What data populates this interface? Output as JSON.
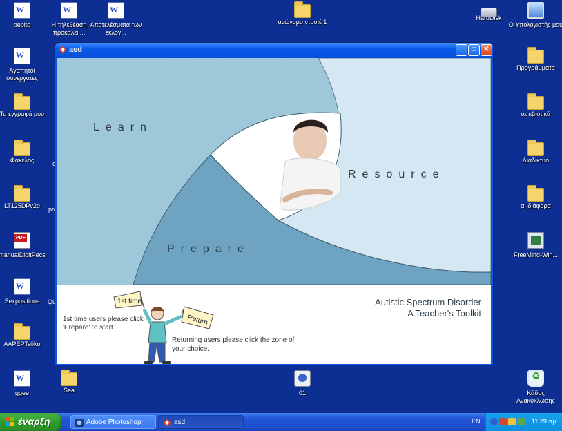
{
  "desktop": {
    "icons": [
      {
        "label": "pepito",
        "icon": "word-doc-icon"
      },
      {
        "label": "Η τηλεθέαση προκαλεί ...",
        "icon": "word-doc-icon"
      },
      {
        "label": "Αποτελέσματα των εκλογ...",
        "icon": "word-doc-icon"
      },
      {
        "label": "ανώνυμο ντοσιέ 1",
        "icon": "folder-icon"
      },
      {
        "label": "HardDisk",
        "icon": "drive-icon"
      },
      {
        "label": "Ο Υπολογιστής μου",
        "icon": "computer-icon"
      },
      {
        "label": "Αγαπητοί συνεργάτες",
        "icon": "word-doc-icon"
      },
      {
        "label": "Τα έγγραφά μου",
        "icon": "folder-icon"
      },
      {
        "label": "Φάκελος",
        "icon": "folder-icon"
      },
      {
        "label": "LT125DPv2p",
        "icon": "folder-icon"
      },
      {
        "label": "manualDigitPecs",
        "icon": "pdf-icon"
      },
      {
        "label": "Sexpositions",
        "icon": "word-doc-icon"
      },
      {
        "label": "AAPEPTeliko",
        "icon": "folder-icon"
      },
      {
        "label": "ggee",
        "icon": "word-doc-icon"
      },
      {
        "label": "Sea",
        "icon": "folder-icon"
      },
      {
        "label": "01",
        "icon": "media-icon"
      },
      {
        "label": "Προγράμματα",
        "icon": "folder-icon"
      },
      {
        "label": "αντιβιοτικά",
        "icon": "folder-icon"
      },
      {
        "label": "Διαδίκτυο",
        "icon": "folder-icon"
      },
      {
        "label": "α_διάφορα",
        "icon": "folder-icon"
      },
      {
        "label": "FreeMind-Win...",
        "icon": "app-icon"
      },
      {
        "label": "Κάδος Ανακύκλωσης",
        "icon": "recycle-bin-icon"
      },
      {
        "label": "e",
        "icon": "partial-icon"
      },
      {
        "label": "pro",
        "icon": "partial-icon"
      },
      {
        "label": "Qu",
        "icon": "partial-icon"
      }
    ]
  },
  "window": {
    "title": "asd",
    "minimize_glyph": "_",
    "maximize_glyph": "□",
    "close_glyph": "✕"
  },
  "app": {
    "zone_learn": "Learn",
    "zone_resource": "Resource",
    "zone_prepare": "Prepare",
    "flag1": "1st time",
    "flag2": "Return",
    "first_time_text": "1st time users please click 'Prepare' to start.",
    "returning_text": "Returning users please click the zone of your choice.",
    "title_line1": "Autistic Spectrum Disorder",
    "title_line2": "- A Teacher's Toolkit",
    "colors": {
      "learn": "#9fc7da",
      "resource": "#d4e7f2",
      "prepare": "#6ea3c2",
      "accent": "#1f5f8e"
    }
  },
  "taskbar": {
    "start_label": "έναρξη",
    "tasks": [
      {
        "label": "Adobe Photoshop",
        "icon": "photoshop-icon"
      },
      {
        "label": "asd",
        "icon": "asd-app-icon"
      }
    ],
    "language": "EN",
    "clock": "11:29 πμ"
  }
}
